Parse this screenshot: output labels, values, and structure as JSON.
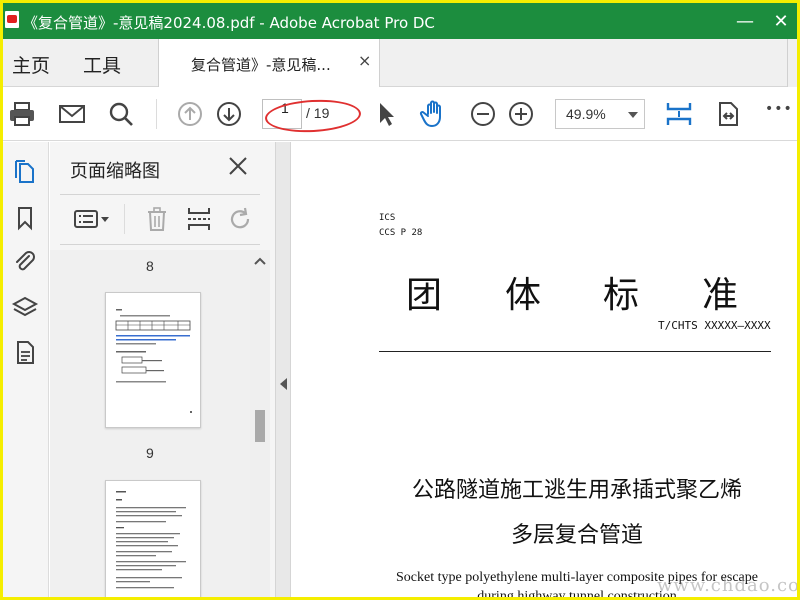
{
  "window": {
    "title": "《复合管道》-意见稿2024.08.pdf - Adobe Acrobat Pro DC",
    "minimize": "—",
    "close": "✕"
  },
  "menu": {
    "home": "主页",
    "tools": "工具"
  },
  "doc_tab": {
    "label": "复合管道》-意见稿...",
    "close": "×"
  },
  "toolbar": {
    "page_current": "1",
    "page_total": "/ 19",
    "zoom": "49.9%",
    "more": "•••"
  },
  "thumbnail_panel": {
    "title": "页面缩略图",
    "page_labels": [
      "8",
      "9"
    ]
  },
  "document": {
    "ics": "ICS",
    "ccs": "CCS P 28",
    "heading_chars": [
      "团",
      "体",
      "标",
      "准"
    ],
    "standard_no": "T/CHTS XXXXX—XXXX",
    "title_line1": "公路隧道施工逃生用承插式聚乙烯",
    "title_line2": "多层复合管道",
    "english_line1": "Socket type polyethylene multi-layer composite pipes for escape",
    "english_line2": "during highway tunnel construction"
  },
  "watermark": "www.chdao.com",
  "colors": {
    "titlebar": "#1c8d3e",
    "border": "#f5ee00",
    "accent_blue": "#1a73c9",
    "highlight_red": "#e03030"
  }
}
